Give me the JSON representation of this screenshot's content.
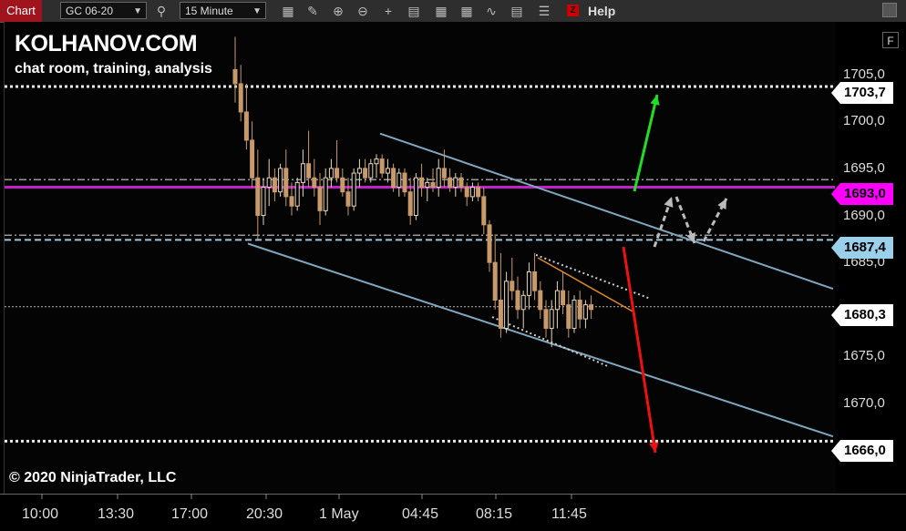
{
  "toolbar": {
    "tab_label": "Chart",
    "instrument": "GC 06-20",
    "interval": "15 Minute",
    "help_label": "Help",
    "icons": [
      "search-icon",
      "bar-type-icon",
      "draw-icon",
      "zoom-in-icon",
      "zoom-out-icon",
      "crosshair-icon",
      "data-box-icon",
      "indicators-icon",
      "strategies-icon",
      "templates-icon",
      "properties-icon",
      "z-order-icon"
    ]
  },
  "branding": {
    "title": "KOLHANOV.COM",
    "subtitle": "chat room, training, analysis",
    "copyright": "© 2020 NinjaTrader, LLC"
  },
  "f_button": "F",
  "colors": {
    "candle_up": "#e8d6b8",
    "candle_down": "#c89a6a",
    "channel": "#7fa6bd",
    "magenta": "#c020c8",
    "green_arrow": "#22dd22",
    "red_arrow": "#ee1111",
    "gray_arrow": "#bbbbbb"
  },
  "chart_data": {
    "type": "candlestick",
    "instrument": "GC 06-20",
    "interval": "15 Minute",
    "ylim": [
      1661,
      1710
    ],
    "y_ticks": [
      "1705,0",
      "1700,0",
      "1695,0",
      "1690,0",
      "1685,0",
      "1680,0",
      "1675,0",
      "1670,0",
      "1665,0"
    ],
    "x_ticks": [
      "10:00",
      "13:30",
      "17:00",
      "20:30",
      "1 May",
      "04:45",
      "08:15",
      "11:45"
    ],
    "price_labels": [
      {
        "name": "upper-target",
        "value": "1703,7",
        "style": "white"
      },
      {
        "name": "magenta-level",
        "value": "1693,0",
        "style": "magenta"
      },
      {
        "name": "dashed-level",
        "value": "1687,4",
        "style": "blue"
      },
      {
        "name": "last-price",
        "value": "1680,3",
        "style": "white"
      },
      {
        "name": "lower-target",
        "value": "1666,0",
        "style": "white"
      }
    ],
    "levels": [
      {
        "price": 1703.7,
        "style": "dotted-white"
      },
      {
        "price": 1693.8,
        "style": "dash-dot-gray"
      },
      {
        "price": 1693.0,
        "style": "solid-magenta"
      },
      {
        "price": 1687.9,
        "style": "dash-dot-gray"
      },
      {
        "price": 1687.4,
        "style": "dashed-blue"
      },
      {
        "price": 1680.3,
        "style": "dotted-gray"
      },
      {
        "price": 1666.0,
        "style": "dotted-white"
      }
    ],
    "candles": [
      [
        1705.5,
        1709,
        1702,
        1704
      ],
      [
        1704,
        1706,
        1700,
        1701
      ],
      [
        1701,
        1704,
        1697,
        1698
      ],
      [
        1698,
        1700,
        1693,
        1694
      ],
      [
        1694,
        1697,
        1687.5,
        1690
      ],
      [
        1690,
        1694,
        1689,
        1693
      ],
      [
        1693,
        1696,
        1691,
        1694
      ],
      [
        1694,
        1695,
        1691.5,
        1692.5
      ],
      [
        1692.5,
        1695.5,
        1692,
        1695
      ],
      [
        1695,
        1697,
        1691,
        1692
      ],
      [
        1692,
        1693.5,
        1690,
        1691
      ],
      [
        1691,
        1694,
        1690.5,
        1693.5
      ],
      [
        1693.5,
        1697,
        1692,
        1695.5
      ],
      [
        1695.5,
        1699,
        1693,
        1694
      ],
      [
        1694,
        1696,
        1692,
        1693
      ],
      [
        1693,
        1694.5,
        1689,
        1690.5
      ],
      [
        1690.5,
        1695,
        1690,
        1694
      ],
      [
        1694,
        1696,
        1693,
        1695
      ],
      [
        1695,
        1698,
        1693.5,
        1694
      ],
      [
        1694,
        1695,
        1692,
        1692.5
      ],
      [
        1692.5,
        1694,
        1690,
        1691
      ],
      [
        1691,
        1695,
        1690.5,
        1694.5
      ],
      [
        1694.5,
        1696,
        1693,
        1695
      ],
      [
        1695,
        1696,
        1693.5,
        1694
      ],
      [
        1694,
        1696,
        1693.5,
        1695.5
      ],
      [
        1695.5,
        1696.5,
        1694,
        1696
      ],
      [
        1696,
        1696.5,
        1694,
        1694.5
      ],
      [
        1694.5,
        1696,
        1693.5,
        1695
      ],
      [
        1695,
        1695.5,
        1692.5,
        1693
      ],
      [
        1693,
        1695,
        1692,
        1694.5
      ],
      [
        1694.5,
        1695,
        1692,
        1692.5
      ],
      [
        1692.5,
        1694,
        1689,
        1690
      ],
      [
        1690,
        1694.5,
        1689.5,
        1694
      ],
      [
        1694,
        1695.5,
        1692,
        1693
      ],
      [
        1693,
        1694,
        1691.5,
        1693.5
      ],
      [
        1693.5,
        1695,
        1692.5,
        1693
      ],
      [
        1693,
        1696,
        1692,
        1695
      ],
      [
        1695,
        1697,
        1693,
        1694
      ],
      [
        1694,
        1695,
        1692.5,
        1693
      ],
      [
        1693,
        1694.5,
        1692,
        1694
      ],
      [
        1694,
        1694.5,
        1692.5,
        1693
      ],
      [
        1693,
        1693.5,
        1691,
        1692
      ],
      [
        1692,
        1693.5,
        1691.5,
        1693
      ],
      [
        1693,
        1693.5,
        1691.5,
        1692
      ],
      [
        1692,
        1693,
        1688,
        1689
      ],
      [
        1689,
        1689.5,
        1684,
        1685
      ],
      [
        1685,
        1688,
        1680,
        1681
      ],
      [
        1681,
        1686,
        1677,
        1678
      ],
      [
        1678,
        1684,
        1677.5,
        1683
      ],
      [
        1683,
        1685.5,
        1681,
        1682
      ],
      [
        1682,
        1683.5,
        1679,
        1680
      ],
      [
        1680,
        1682,
        1678,
        1681.5
      ],
      [
        1681.5,
        1685,
        1680,
        1684
      ],
      [
        1684,
        1686,
        1681,
        1682
      ],
      [
        1682,
        1683,
        1679,
        1680
      ],
      [
        1680,
        1681,
        1677,
        1678
      ],
      [
        1678,
        1681,
        1676,
        1680
      ],
      [
        1680,
        1683,
        1678,
        1682
      ],
      [
        1682,
        1684,
        1679.5,
        1680.5
      ],
      [
        1680.5,
        1682,
        1677,
        1678
      ],
      [
        1678,
        1681.5,
        1677.5,
        1681
      ],
      [
        1681,
        1682,
        1678,
        1679
      ],
      [
        1679,
        1681,
        1678,
        1680.5
      ],
      [
        1680.5,
        1681.5,
        1679,
        1680
      ]
    ],
    "channel_lines": [
      {
        "from": [
          "bar 21",
          1698.7
        ],
        "to": [
          "right-edge",
          1682.2
        ]
      },
      {
        "from": [
          "bar 2",
          1687
        ],
        "to": [
          "right-edge",
          1666.5
        ]
      }
    ]
  }
}
